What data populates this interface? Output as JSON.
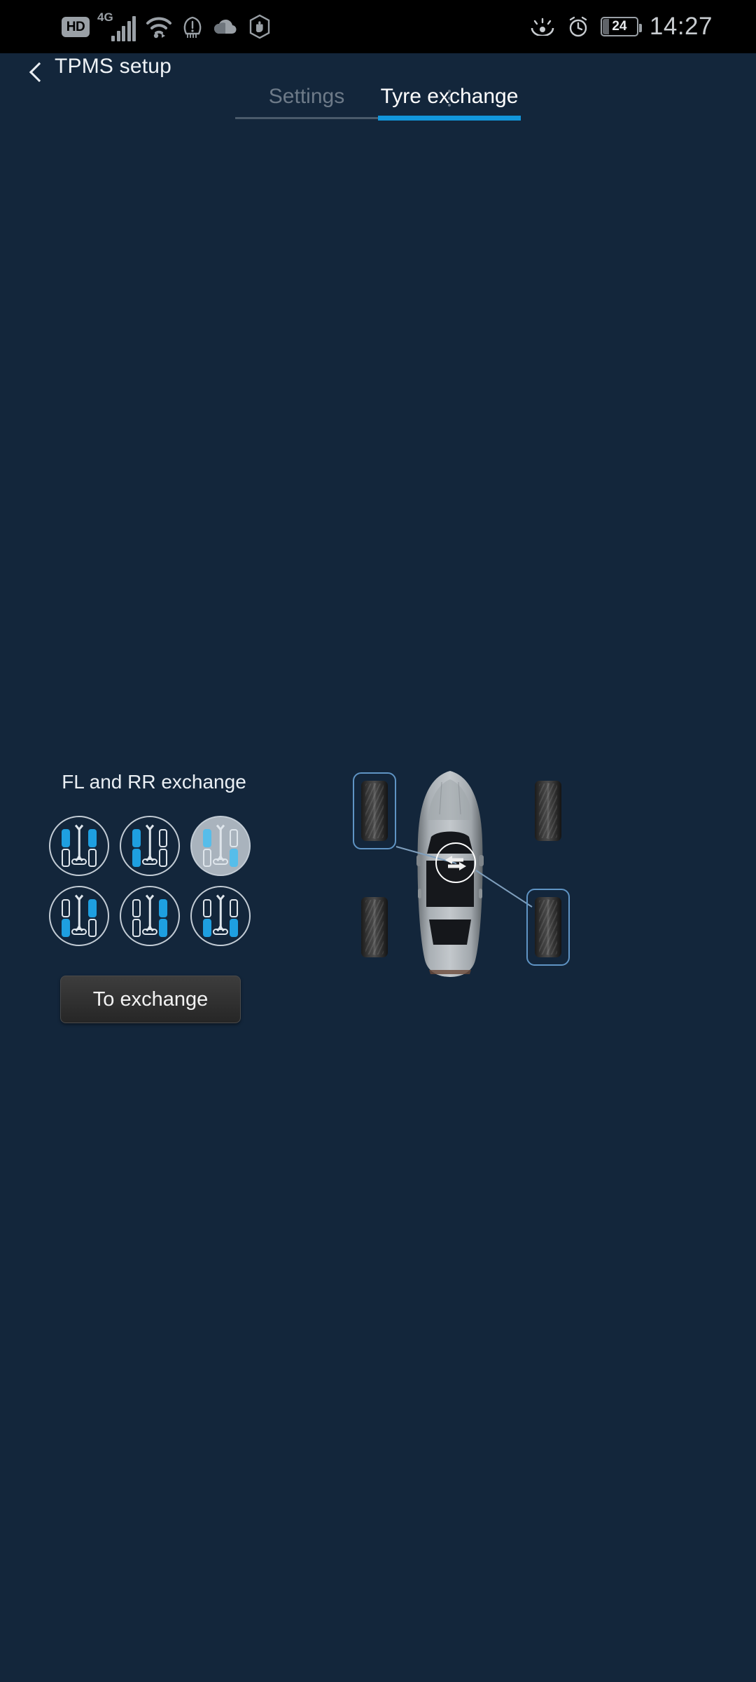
{
  "status_bar": {
    "icons": [
      "hd-icon",
      "4g-signal-icon",
      "wifi-icon",
      "tpms-warning-icon",
      "cloud-icon",
      "hand-stop-icon"
    ],
    "network_label": "4G",
    "hd_label": "HD",
    "battery_level": "24",
    "time": "14:27"
  },
  "app_bar": {
    "back_icon": "back-chevron-icon",
    "title": "TPMS setup"
  },
  "tabs": [
    {
      "label": "Settings",
      "active": false
    },
    {
      "label": "Tyre exchange",
      "active": true
    }
  ],
  "panel": {
    "title": "FL and RR exchange",
    "options": [
      {
        "id": "fl-fr",
        "name": "FL and FR exchange",
        "selected": false,
        "highlight": [
          "fl",
          "fr"
        ]
      },
      {
        "id": "fl-rl",
        "name": "FL and RL exchange",
        "selected": false,
        "highlight": [
          "fl",
          "rl"
        ]
      },
      {
        "id": "fl-rr",
        "name": "FL and RR exchange",
        "selected": true,
        "highlight": [
          "fl",
          "rr"
        ]
      },
      {
        "id": "fr-rl",
        "name": "FR and RL exchange",
        "selected": false,
        "highlight": [
          "fr",
          "rl"
        ]
      },
      {
        "id": "fr-rr",
        "name": "FR and RR exchange",
        "selected": false,
        "highlight": [
          "fr",
          "rr"
        ]
      },
      {
        "id": "rl-rr",
        "name": "RL and RR exchange",
        "selected": false,
        "highlight": [
          "rl",
          "rr"
        ]
      }
    ],
    "exchange_button": "To exchange"
  },
  "diagram": {
    "swap_icon": "swap-arrows-icon",
    "car_icon": "car-top-view",
    "tyres": [
      {
        "position": "FL",
        "highlighted": true
      },
      {
        "position": "FR",
        "highlighted": false
      },
      {
        "position": "RL",
        "highlighted": false
      },
      {
        "position": "RR",
        "highlighted": true
      }
    ]
  },
  "colors": {
    "background": "#13263B",
    "accent_blue": "#1296DB",
    "tyre_blue": "#1E9FE0",
    "highlight_border": "#5f94c4",
    "status_bar": "#000000"
  }
}
